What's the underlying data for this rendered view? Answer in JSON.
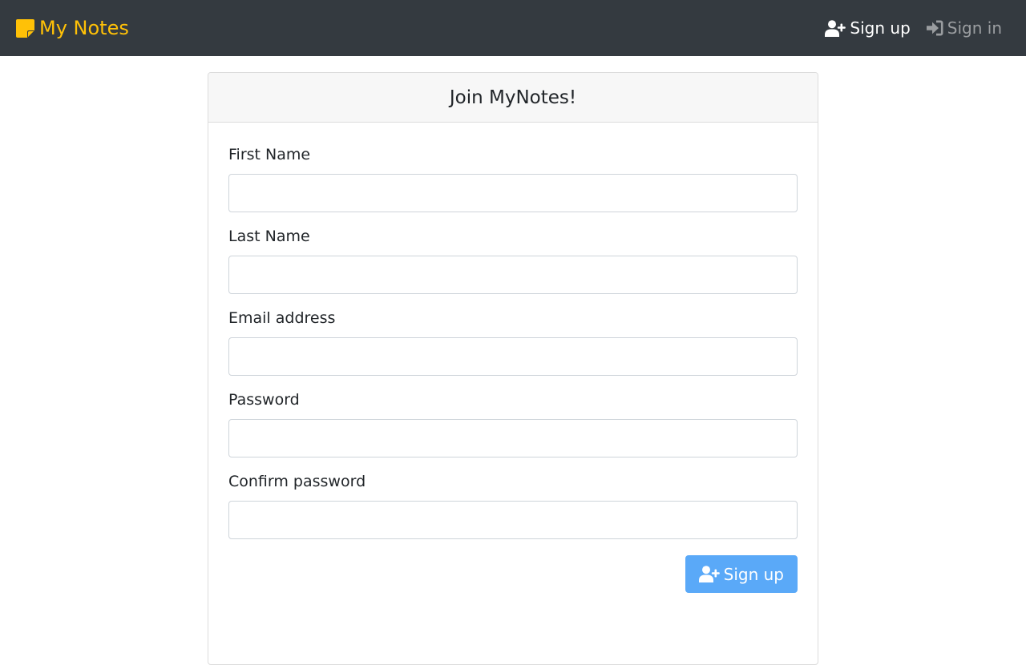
{
  "navbar": {
    "brand_label": "My Notes",
    "brand_icon": "sticky-note-icon",
    "links": [
      {
        "label": "Sign up",
        "icon": "user-plus-icon",
        "active": true
      },
      {
        "label": "Sign in",
        "icon": "sign-in-icon",
        "active": false
      }
    ]
  },
  "card": {
    "title": "Join MyNotes!",
    "fields": [
      {
        "label": "First Name",
        "value": "",
        "placeholder": ""
      },
      {
        "label": "Last Name",
        "value": "",
        "placeholder": ""
      },
      {
        "label": "Email address",
        "value": "",
        "placeholder": ""
      },
      {
        "label": "Password",
        "value": "",
        "placeholder": ""
      },
      {
        "label": "Confirm password",
        "value": "",
        "placeholder": ""
      }
    ],
    "submit_label": "Sign up",
    "submit_icon": "user-plus-icon"
  },
  "colors": {
    "navbar_bg": "#343a40",
    "brand": "#ffc107",
    "primary_button": "#5aa9f8",
    "card_header_bg": "#f7f7f7"
  }
}
